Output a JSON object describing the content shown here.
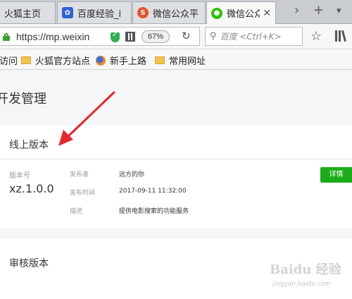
{
  "browser": {
    "tabs": [
      {
        "label": "火狐主页",
        "icon": "firefox-home-icon",
        "active": false
      },
      {
        "label": "百度经验_i",
        "icon": "baidu-paw-icon",
        "active": false
      },
      {
        "label": "微信公众平",
        "icon": "sogou-icon",
        "active": false
      },
      {
        "label": "微信公众",
        "icon": "wechat-icon",
        "active": true
      }
    ],
    "tab_scroll_icon": "chevron-right-icon",
    "new_tab_label": "+",
    "tab_list_icon": "chevron-down-icon",
    "url": "https://mp.weixin",
    "zoom": "67%",
    "search_placeholder": "百度 <Ctrl+K>",
    "accent_secure": "#3aa02c"
  },
  "bookmarks": [
    {
      "label": "访问",
      "icon": "none"
    },
    {
      "label": "火狐官方站点",
      "icon": "folder-icon"
    },
    {
      "label": "新手上路",
      "icon": "firefox-icon"
    },
    {
      "label": "常用网址",
      "icon": "folder-icon"
    }
  ],
  "page": {
    "title": "开发管理",
    "online": {
      "title": "线上版本",
      "version_label": "版本号",
      "version": "xz.1.0.0",
      "publisher_label": "发布者",
      "publisher": "远方的你",
      "time_label": "发布时间",
      "time": "2017-09-11 11:32:00",
      "desc_label": "描述",
      "desc": "提供电影搜索的功能服务",
      "detail_button": "详情"
    },
    "review": {
      "title": "审核版本"
    }
  },
  "annotation": {
    "color": "#e8262a"
  },
  "watermark": {
    "logo": "Baidu 经验",
    "sub": "jingyan.baidu.com"
  }
}
